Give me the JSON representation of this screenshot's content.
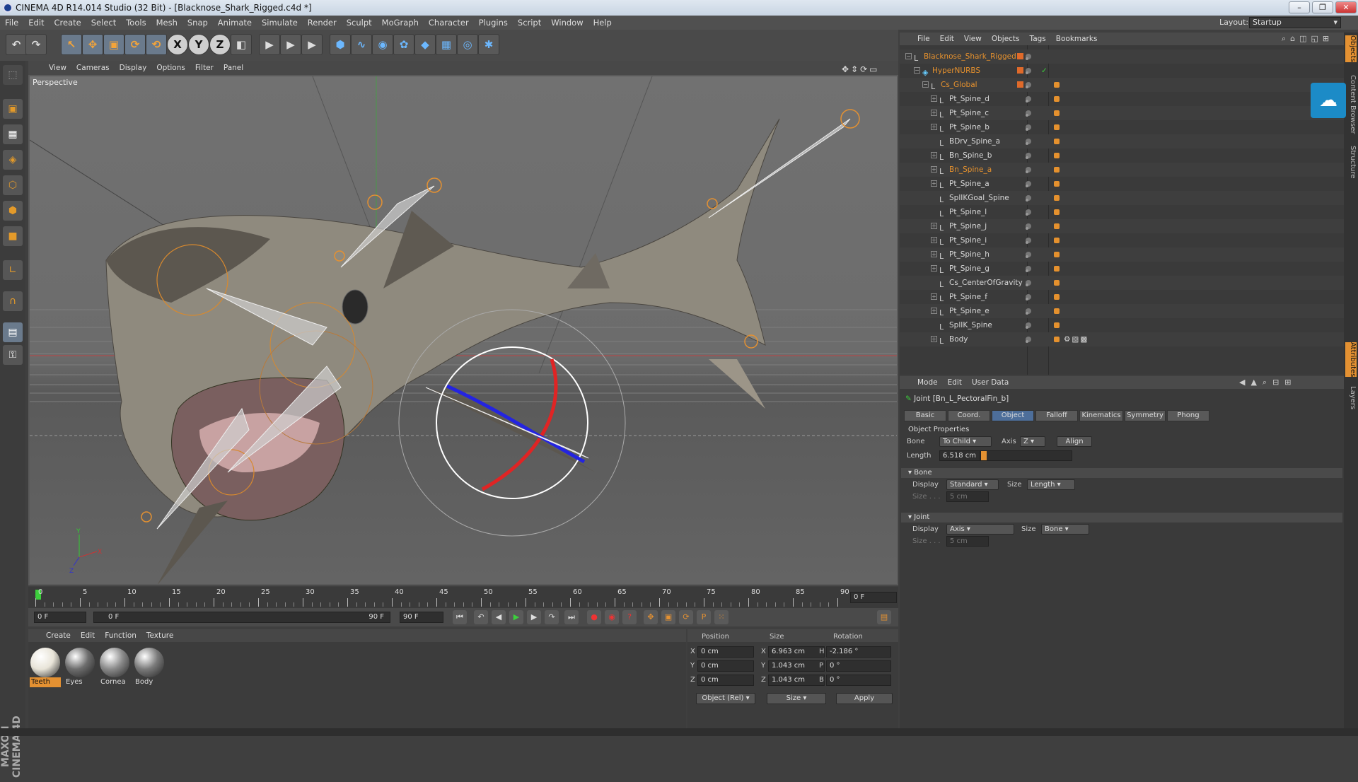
{
  "window": {
    "title": "CINEMA 4D R14.014 Studio (32 Bit) - [Blacknose_Shark_Rigged.c4d *]"
  },
  "menubar": [
    "File",
    "Edit",
    "Create",
    "Select",
    "Tools",
    "Mesh",
    "Snap",
    "Animate",
    "Simulate",
    "Render",
    "Sculpt",
    "MoGraph",
    "Character",
    "Plugins",
    "Script",
    "Window",
    "Help"
  ],
  "layout": {
    "label": "Layout:",
    "value": "Startup"
  },
  "toolbar_icons": [
    "undo-icon",
    "redo-icon",
    "select-icon",
    "move-icon",
    "scale-icon",
    "rotate-icon",
    "rotate-live-icon",
    "x-axis-icon",
    "y-axis-icon",
    "z-axis-icon",
    "coord-system-icon",
    "render-view-icon",
    "render-picture-queue-icon",
    "render-settings-icon",
    "cube-icon",
    "spline-icon",
    "nurbs-icon",
    "array-icon",
    "deformer-icon",
    "floor-icon",
    "camera-icon",
    "light-icon"
  ],
  "toolbar_axes": [
    "X",
    "Y",
    "Z"
  ],
  "viewport": {
    "menu": [
      "View",
      "Cameras",
      "Display",
      "Options",
      "Filter",
      "Panel"
    ],
    "label": "Perspective",
    "axis_x": "X",
    "axis_y": "Y",
    "axis_z": "Z"
  },
  "timeline": {
    "ticks": [
      "0",
      "5",
      "10",
      "15",
      "20",
      "25",
      "30",
      "35",
      "40",
      "45",
      "50",
      "55",
      "60",
      "65",
      "70",
      "75",
      "80",
      "85",
      "90"
    ],
    "current_frame": "0 F",
    "start_field": "0 F",
    "range_start": "0 F",
    "range_end": "90 F",
    "end_field": "90 F"
  },
  "materials": {
    "menu": [
      "Create",
      "Edit",
      "Function",
      "Texture"
    ],
    "items": [
      {
        "name": "Teeth",
        "color": "#e8e4d8"
      },
      {
        "name": "Eyes",
        "color": "#6d6d6d"
      },
      {
        "name": "Cornea",
        "color": "#8a8a8a"
      },
      {
        "name": "Body",
        "color": "#7a7a7a"
      }
    ]
  },
  "coords": {
    "headers": [
      "Position",
      "Size",
      "Rotation"
    ],
    "rows": [
      {
        "axis": "X",
        "pos": "0 cm",
        "size_axis": "X",
        "size": "6.963 cm",
        "rot_axis": "H",
        "rot": "-2.186 °"
      },
      {
        "axis": "Y",
        "pos": "0 cm",
        "size_axis": "Y",
        "size": "1.043 cm",
        "rot_axis": "P",
        "rot": "0 °"
      },
      {
        "axis": "Z",
        "pos": "0 cm",
        "size_axis": "Z",
        "size": "1.043 cm",
        "rot_axis": "B",
        "rot": "0 °"
      }
    ],
    "mode": "Object (Rel)",
    "size_mode": "Size",
    "apply": "Apply"
  },
  "object_manager": {
    "menu": [
      "File",
      "Edit",
      "View",
      "Objects",
      "Tags",
      "Bookmarks"
    ],
    "objects": [
      {
        "name": "Blacknose_Shark_Rigged",
        "indent": 0,
        "hi": true,
        "exp": "-"
      },
      {
        "name": "HyperNURBS",
        "indent": 1,
        "hi": true,
        "exp": "-"
      },
      {
        "name": "Cs_Global",
        "indent": 2,
        "hi": true,
        "exp": "-"
      },
      {
        "name": "Pt_Spine_d",
        "indent": 3,
        "hi": false,
        "exp": "+"
      },
      {
        "name": "Pt_Spine_c",
        "indent": 3,
        "hi": false,
        "exp": "+"
      },
      {
        "name": "Pt_Spine_b",
        "indent": 3,
        "hi": false,
        "exp": "+"
      },
      {
        "name": "BDrv_Spine_a",
        "indent": 3,
        "hi": false,
        "exp": ""
      },
      {
        "name": "Bn_Spine_b",
        "indent": 3,
        "hi": false,
        "exp": "+"
      },
      {
        "name": "Bn_Spine_a",
        "indent": 3,
        "hi": true,
        "exp": "+"
      },
      {
        "name": "Pt_Spine_a",
        "indent": 3,
        "hi": false,
        "exp": "+"
      },
      {
        "name": "SplIKGoal_Spine",
        "indent": 3,
        "hi": false,
        "exp": ""
      },
      {
        "name": "Pt_Spine_l",
        "indent": 3,
        "hi": false,
        "exp": ""
      },
      {
        "name": "Pt_Spine_j",
        "indent": 3,
        "hi": false,
        "exp": "+"
      },
      {
        "name": "Pt_Spine_i",
        "indent": 3,
        "hi": false,
        "exp": "+"
      },
      {
        "name": "Pt_Spine_h",
        "indent": 3,
        "hi": false,
        "exp": "+"
      },
      {
        "name": "Pt_Spine_g",
        "indent": 3,
        "hi": false,
        "exp": "+"
      },
      {
        "name": "Cs_CenterOfGravity",
        "indent": 3,
        "hi": false,
        "exp": ""
      },
      {
        "name": "Pt_Spine_f",
        "indent": 3,
        "hi": false,
        "exp": "+"
      },
      {
        "name": "Pt_Spine_e",
        "indent": 3,
        "hi": false,
        "exp": "+"
      },
      {
        "name": "SplIK_Spine",
        "indent": 3,
        "hi": false,
        "exp": ""
      },
      {
        "name": "Body",
        "indent": 3,
        "hi": false,
        "exp": "+"
      }
    ]
  },
  "attributes": {
    "menu": [
      "Mode",
      "Edit",
      "User Data"
    ],
    "object_label": "Joint [Bn_L_PectoralFin_b]",
    "tabs": [
      "Basic",
      "Coord.",
      "Object",
      "Falloff",
      "Kinematics",
      "Symmetry",
      "Phong"
    ],
    "active_tab": "Object",
    "section_title": "Object Properties",
    "bone_label": "Bone",
    "bone_value": "To Child",
    "axis_label": "Axis",
    "axis_value": "Z",
    "align_label": "Align",
    "length_label": "Length",
    "length_value": "6.518 cm",
    "bone_section": "Bone",
    "display_label": "Display",
    "bone_display_value": "Standard",
    "size_label": "Size",
    "bone_size_value": "Length",
    "size_dots_label": "Size . . .",
    "bone_size_field": "5 cm",
    "joint_section": "Joint",
    "joint_display_value": "Axis",
    "joint_size_value": "Bone",
    "joint_size_field": "5 cm"
  },
  "side_tabs": [
    "Objects",
    "Content Browser",
    "Structure",
    "Attributes",
    "Layers"
  ],
  "brand": "MAXON CINEMA 4D"
}
